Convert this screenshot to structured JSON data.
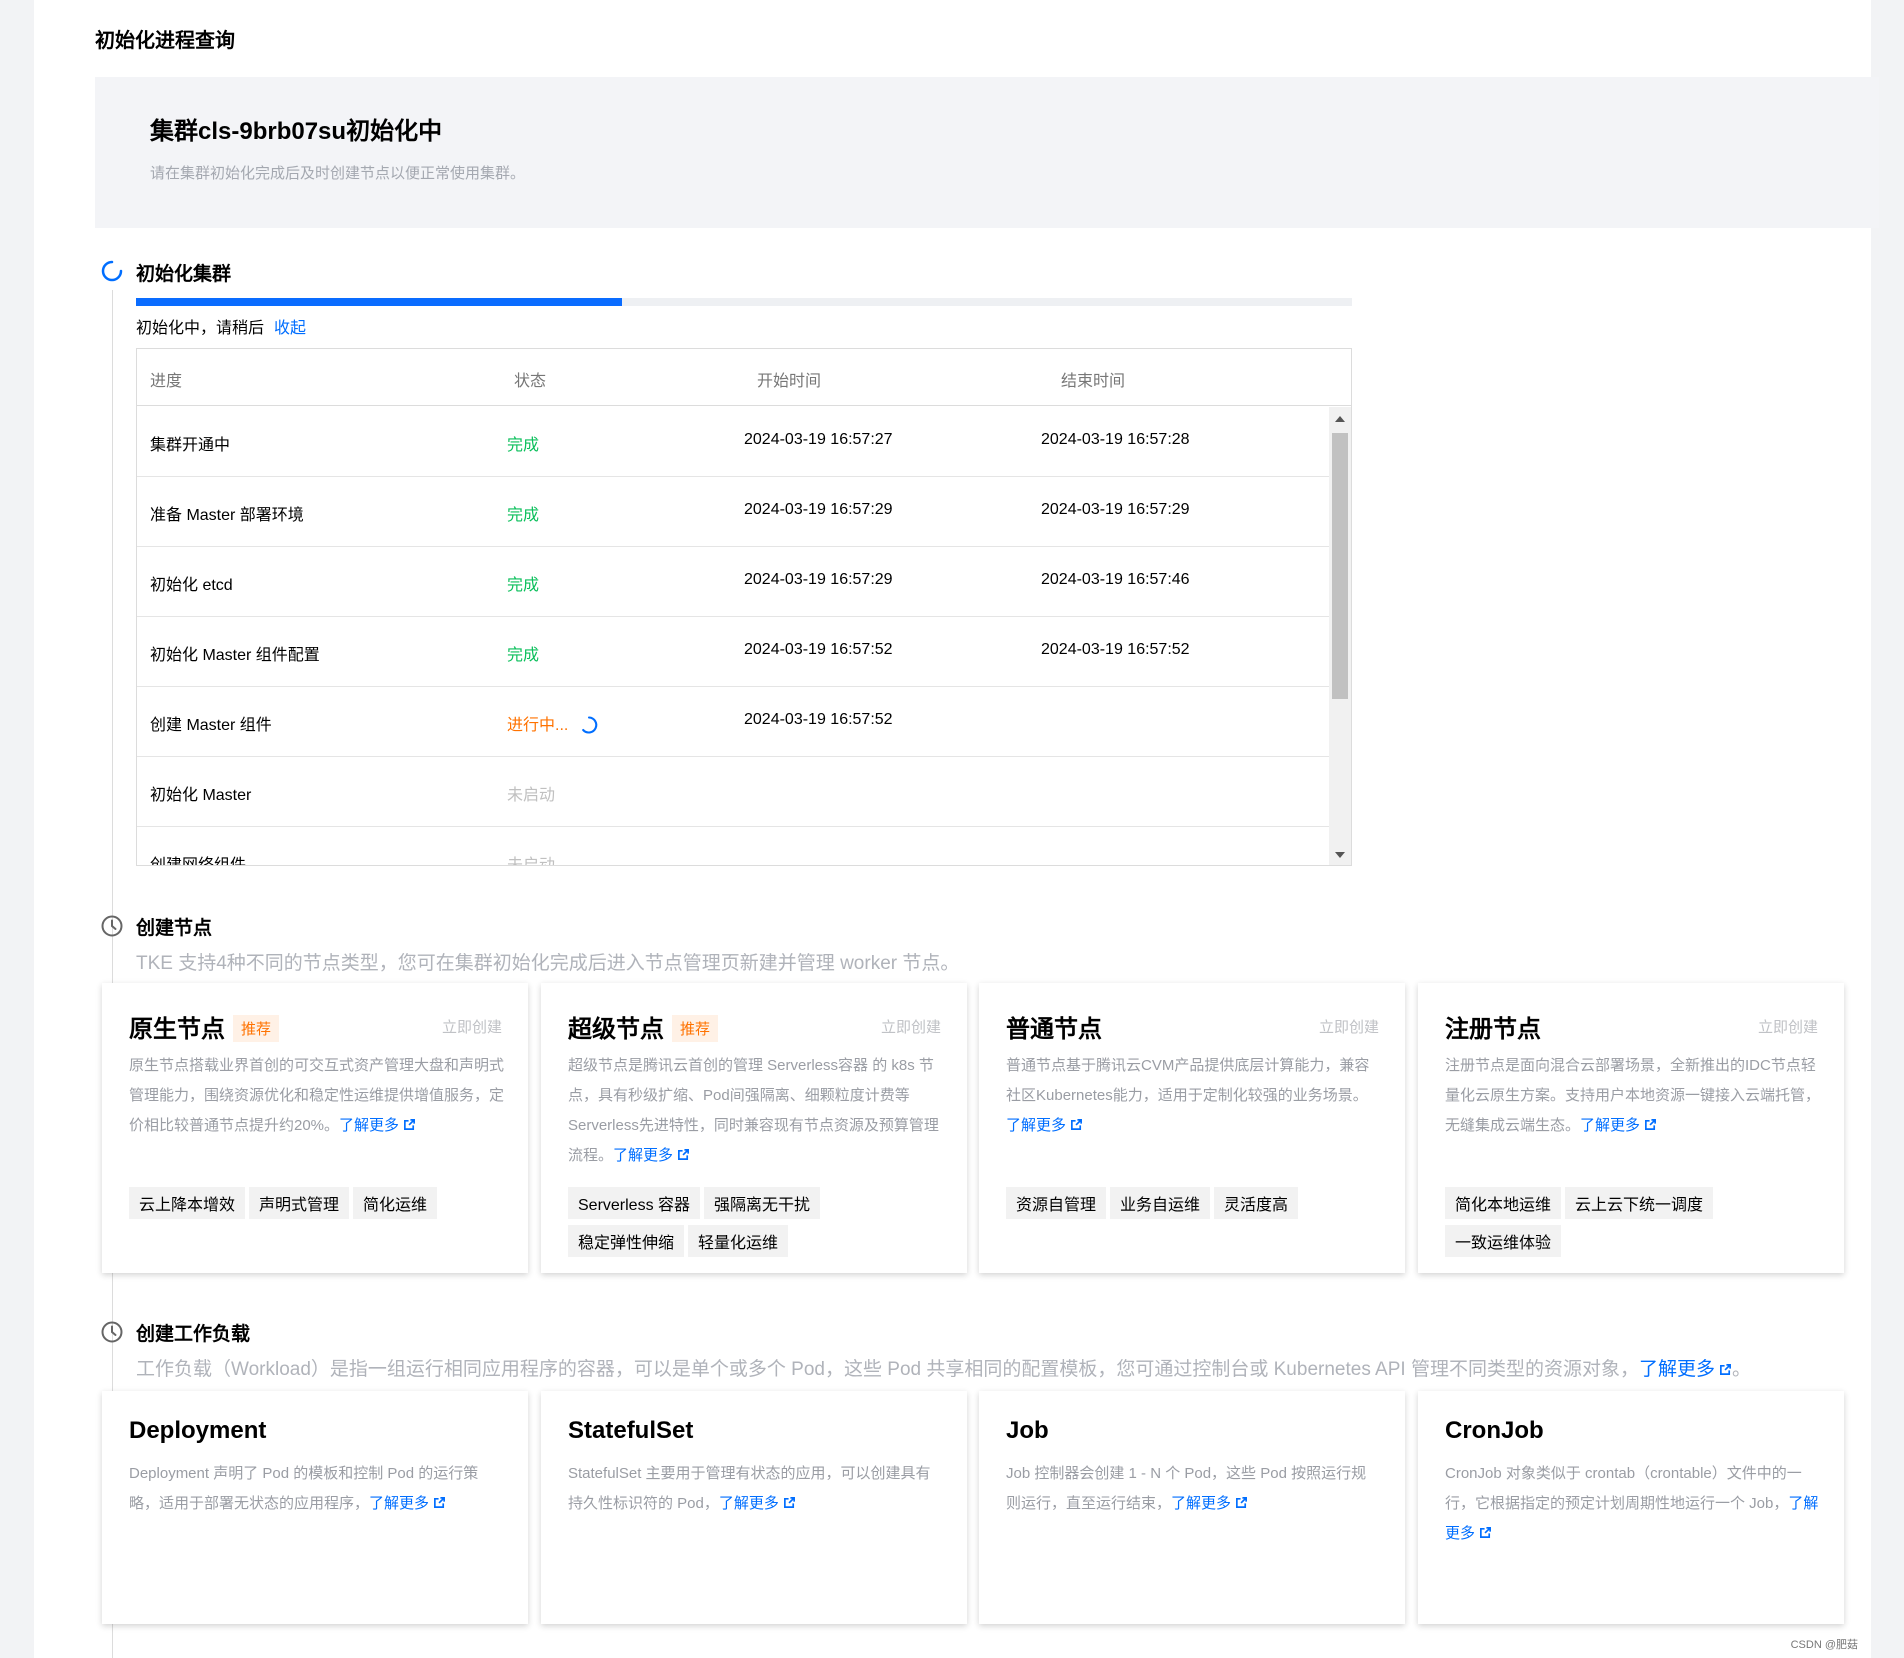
{
  "page": {
    "title": "初始化进程查询"
  },
  "banner": {
    "title": "集群cls-9brb07su初始化中",
    "desc": "请在集群初始化完成后及时创建节点以便正常使用集群。"
  },
  "steps": {
    "init": {
      "title": "初始化集群",
      "progress": 0.4,
      "progress_text": "初始化中，请稍后",
      "collapse": "收起"
    },
    "nodes": {
      "title": "创建节点",
      "desc": "TKE 支持4种不同的节点类型，您可在集群初始化完成后进入节点管理页新建并管理 worker 节点。"
    },
    "workloads": {
      "title": "创建工作负载",
      "desc": "工作负载（Workload）是指一组运行相同应用程序的容器，可以是单个或多个 Pod，这些 Pod 共享相同的配置模板，您可通过控制台或 Kubernetes API 管理不同类型的资源对象，",
      "more": "了解更多",
      "end": "。"
    }
  },
  "table": {
    "headers": [
      "进度",
      "状态",
      "开始时间",
      "结束时间"
    ],
    "rows": [
      {
        "name": "集群开通中",
        "status": "完成",
        "start": "2024-03-19 16:57:27",
        "end": "2024-03-19 16:57:28"
      },
      {
        "name": "准备 Master 部署环境",
        "status": "完成",
        "start": "2024-03-19 16:57:29",
        "end": "2024-03-19 16:57:29"
      },
      {
        "name": "初始化 etcd",
        "status": "完成",
        "start": "2024-03-19 16:57:29",
        "end": "2024-03-19 16:57:46"
      },
      {
        "name": "初始化 Master 组件配置",
        "status": "完成",
        "start": "2024-03-19 16:57:52",
        "end": "2024-03-19 16:57:52"
      },
      {
        "name": "创建 Master 组件",
        "status": "进行中...",
        "start": "2024-03-19 16:57:52",
        "end": ""
      },
      {
        "name": "初始化 Master",
        "status": "未启动",
        "start": "",
        "end": ""
      },
      {
        "name": "创建网络组件",
        "status": "未启动",
        "start": "",
        "end": ""
      }
    ]
  },
  "node_cards": [
    {
      "title": "原生节点",
      "badge": "推荐",
      "create": "立即创建",
      "desc": "原生节点搭载业界首创的可交互式资产管理大盘和声明式管理能力，围绕资源优化和稳定性运维提供增值服务，定价相比较普通节点提升约20%。",
      "more": "了解更多",
      "tags": [
        "云上降本增效",
        "声明式管理",
        "简化运维"
      ]
    },
    {
      "title": "超级节点",
      "badge": "推荐",
      "create": "立即创建",
      "desc": "超级节点是腾讯云首创的管理 Serverless容器 的 k8s 节点，具有秒级扩缩、Pod间强隔离、细颗粒度计费等Serverless先进特性，同时兼容现有节点资源及预算管理流程。",
      "more": "了解更多",
      "tags": [
        "Serverless 容器",
        "强隔离无干扰",
        "稳定弹性伸缩",
        "轻量化运维"
      ]
    },
    {
      "title": "普通节点",
      "badge": "",
      "create": "立即创建",
      "desc": "普通节点基于腾讯云CVM产品提供底层计算能力，兼容社区Kubernetes能力，适用于定制化较强的业务场景。",
      "more": "了解更多",
      "tags": [
        "资源自管理",
        "业务自运维",
        "灵活度高"
      ]
    },
    {
      "title": "注册节点",
      "badge": "",
      "create": "立即创建",
      "desc": "注册节点是面向混合云部署场景，全新推出的IDC节点轻量化云原生方案。支持用户本地资源一键接入云端托管，无缝集成云端生态。",
      "more": "了解更多",
      "tags": [
        "简化本地运维",
        "云上云下统一调度",
        "一致运维体验"
      ]
    }
  ],
  "workload_cards": [
    {
      "title": "Deployment",
      "desc": "Deployment 声明了 Pod 的模板和控制 Pod 的运行策略，适用于部署无状态的应用程序，",
      "more": "了解更多"
    },
    {
      "title": "StatefulSet",
      "desc": "StatefulSet 主要用于管理有状态的应用，可以创建具有持久性标识符的 Pod，",
      "more": "了解更多"
    },
    {
      "title": "Job",
      "desc": "Job 控制器会创建 1 - N 个 Pod，这些 Pod 按照运行规则运行，直至运行结束，",
      "more": "了解更多"
    },
    {
      "title": "CronJob",
      "desc": "CronJob 对象类似于 crontab（crontable）文件中的一行，它根据指定的预定计划周期性地运行一个 Job，",
      "more": "了解更多"
    }
  ],
  "watermark": "CSDN @肥菇",
  "colors": {
    "accent": "#006eff",
    "done": "#0abf5b",
    "running": "#ff7200",
    "pending": "#c0c0c0"
  }
}
